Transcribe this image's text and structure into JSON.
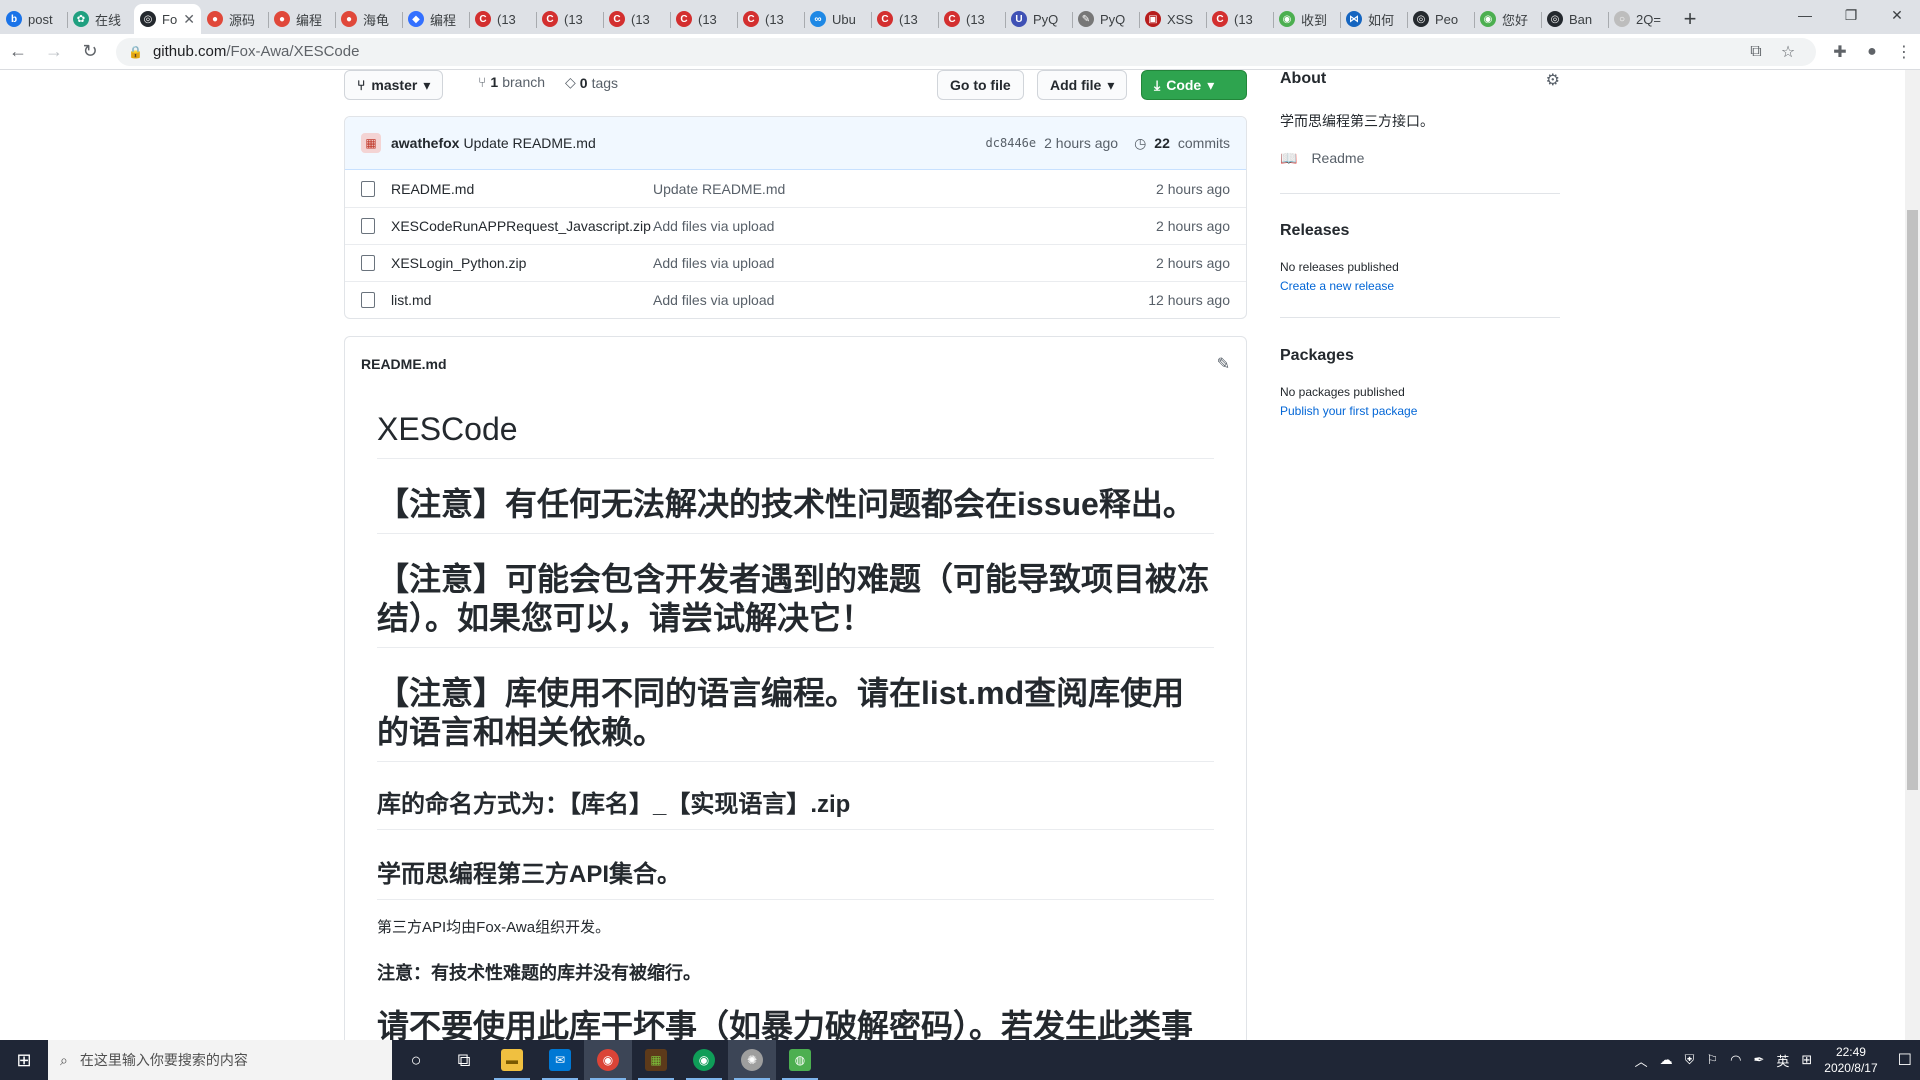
{
  "browser": {
    "tabs": [
      {
        "title": "post",
        "fav": "b",
        "color": "#1a73e8"
      },
      {
        "title": "在线",
        "fav": "✿",
        "color": "#20a080"
      },
      {
        "title": "Fo",
        "fav": "◎",
        "color": "#24292e",
        "active": true
      },
      {
        "title": "源码",
        "fav": "●",
        "color": "#e0483a"
      },
      {
        "title": "编程",
        "fav": "●",
        "color": "#e0483a"
      },
      {
        "title": "海龟",
        "fav": "●",
        "color": "#e0483a"
      },
      {
        "title": "编程",
        "fav": "◆",
        "color": "#3370ff"
      },
      {
        "title": "(13",
        "fav": "C",
        "color": "#d32f2f"
      },
      {
        "title": "(13",
        "fav": "C",
        "color": "#d32f2f"
      },
      {
        "title": "(13",
        "fav": "C",
        "color": "#d32f2f"
      },
      {
        "title": "(13",
        "fav": "C",
        "color": "#d32f2f"
      },
      {
        "title": "(13",
        "fav": "C",
        "color": "#d32f2f"
      },
      {
        "title": "Ubu",
        "fav": "∞",
        "color": "#1e88e5"
      },
      {
        "title": "(13",
        "fav": "C",
        "color": "#d32f2f"
      },
      {
        "title": "(13",
        "fav": "C",
        "color": "#d32f2f"
      },
      {
        "title": "PyQ",
        "fav": "U",
        "color": "#3f51b5"
      },
      {
        "title": "PyQ",
        "fav": "✎",
        "color": "#777777"
      },
      {
        "title": "XSS",
        "fav": "▣",
        "color": "#b71c1c"
      },
      {
        "title": "(13",
        "fav": "C",
        "color": "#d32f2f"
      },
      {
        "title": "收到",
        "fav": "◉",
        "color": "#4caf50"
      },
      {
        "title": "如何",
        "fav": "⋈",
        "color": "#1565c0"
      },
      {
        "title": "Peo",
        "fav": "◎",
        "color": "#24292e"
      },
      {
        "title": "您好",
        "fav": "◉",
        "color": "#4caf50"
      },
      {
        "title": "Ban",
        "fav": "◎",
        "color": "#24292e"
      },
      {
        "title": "2Q=",
        "fav": "○",
        "color": "#bdbdbd"
      }
    ],
    "url_host": "github.com",
    "url_path": "/Fox-Awa/XESCode"
  },
  "repo": {
    "branch_button": "master",
    "branch_count": "1",
    "branch_label": "branch",
    "tag_count": "0",
    "tag_label": "tags",
    "go_to_file": "Go to file",
    "add_file": "Add file",
    "code": "Code",
    "commit": {
      "author": "awathefox",
      "message": "Update README.md",
      "sha": "dc8446e",
      "age": "2 hours ago",
      "count": "22",
      "count_label": "commits"
    },
    "files": [
      {
        "name": "README.md",
        "message": "Update README.md",
        "age": "2 hours ago"
      },
      {
        "name": "XESCodeRunAPPRequest_Javascript.zip",
        "message": "Add files via upload",
        "age": "2 hours ago"
      },
      {
        "name": "XESLogin_Python.zip",
        "message": "Add files via upload",
        "age": "2 hours ago"
      },
      {
        "name": "list.md",
        "message": "Add files via upload",
        "age": "12 hours ago"
      }
    ]
  },
  "readme": {
    "filename": "README.md",
    "title": "XESCode",
    "note1": "【注意】有任何无法解决的技术性问题都会在issue释出。",
    "note2": "【注意】可能会包含开发者遇到的难题（可能导致项目被冻结）。如果您可以，请尝试解决它！",
    "note3": "【注意】库使用不同的语言编程。请在list.md查阅库使用的语言和相关依赖。",
    "naming": "库的命名方式为：【库名】_【实现语言】.zip",
    "collection": "学而思编程第三方API集合。",
    "developed_by": "第三方API均由Fox-Awa组织开发。",
    "attention": "注意：有技术性难题的库并没有被缩行。",
    "warning": "请不要使用此库干坏事（如暴力破解密码）。若发生此类事"
  },
  "sidebar": {
    "about_title": "About",
    "description": "学而思编程第三方接口。",
    "readme_link": "Readme",
    "releases_title": "Releases",
    "releases_none": "No releases published",
    "releases_create": "Create a new release",
    "packages_title": "Packages",
    "packages_none": "No packages published",
    "packages_publish": "Publish your first package"
  },
  "taskbar": {
    "search_placeholder": "在这里输入你要搜索的内容",
    "ime": "英",
    "time": "22:49",
    "date": "2020/8/17"
  }
}
